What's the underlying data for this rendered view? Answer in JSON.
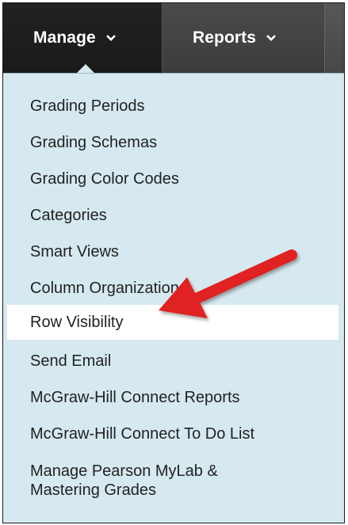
{
  "navbar": {
    "tabs": [
      {
        "label": "Manage"
      },
      {
        "label": "Reports"
      }
    ]
  },
  "menu": {
    "items": [
      {
        "label": "Grading Periods"
      },
      {
        "label": "Grading Schemas"
      },
      {
        "label": "Grading Color Codes"
      },
      {
        "label": "Categories"
      },
      {
        "label": "Smart Views"
      },
      {
        "label": "Column Organization"
      },
      {
        "label": "Row Visibility"
      },
      {
        "label": "Send Email"
      },
      {
        "label": "McGraw-Hill Connect Reports"
      },
      {
        "label": "McGraw-Hill Connect To Do List"
      },
      {
        "label": "Manage Pearson MyLab & Mastering Grades"
      }
    ]
  },
  "colors": {
    "navbar": "#2a2a2a",
    "menu_background": "#d6e9f0",
    "highlight": "#ffffff",
    "annotation_arrow": "#e02020"
  }
}
